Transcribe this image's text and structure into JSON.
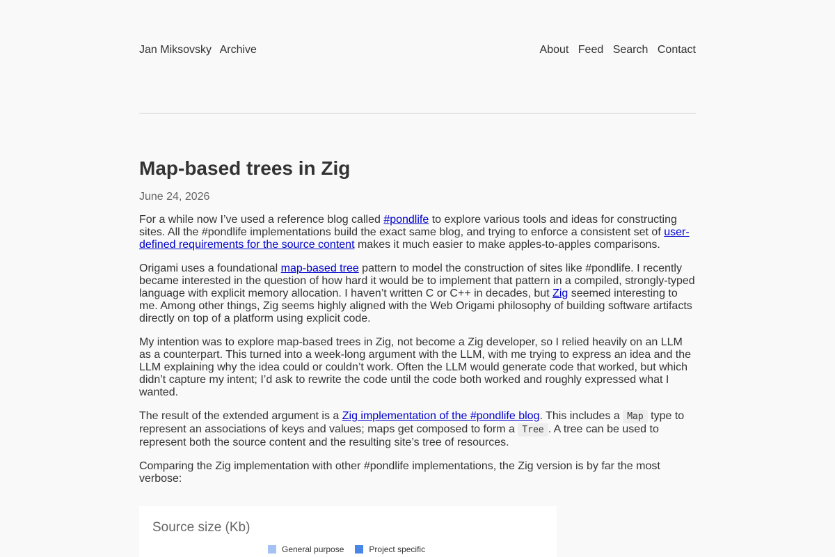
{
  "nav": {
    "left": [
      "Jan Miksovsky",
      "Archive"
    ],
    "right": [
      "About",
      "Feed",
      "Search",
      "Contact"
    ]
  },
  "post": {
    "title": "Map-based trees in Zig",
    "date": "June 24, 2026",
    "p1": {
      "t1": "For a while now I’ve used a reference blog called ",
      "link1": "#pondlife",
      "t2": " to explore various tools and ideas for constructing sites. All the #pondlife implementations build the exact same blog, and trying to enforce a consistent set of ",
      "link2": "user-defined requirements for the source content",
      "t3": " makes it much easier to make apples-to-apples comparisons."
    },
    "p2": {
      "t1": "Origami uses a foundational ",
      "link1": "map-based tree",
      "t2": " pattern to model the construction of sites like #pondlife. I recently became interested in the question of how hard it would be to implement that pattern in a compiled, strongly-typed language with explicit memory allocation. I haven’t written C or C++ in decades, but ",
      "link2": "Zig",
      "t3": " seemed interesting to me. Among other things, Zig seems highly aligned with the Web Origami philosophy of building software artifacts directly on top of a platform using explicit code."
    },
    "p3": "My intention was to explore map-based trees in Zig, not become a Zig developer, so I relied heavily on an LLM as a counterpart. This turned into a week-long argument with the LLM, with me trying to express an idea and the LLM explaining why the idea could or couldn’t work. Often the LLM would generate code that worked, but which didn’t capture my intent; I’d ask to rewrite the code until the code both worked and roughly expressed what I wanted.",
    "p4": {
      "t1": "The result of the extended argument is a ",
      "link1": "Zig implementation of the #pondlife blog",
      "t2": ". This includes a ",
      "code1": "Map",
      "t3": " type to represent an associations of keys and values; maps get composed to form a ",
      "code2": "Tree",
      "t4": ". A tree can be used to represent both the source content and the resulting site’s tree of resources."
    },
    "p5": "Comparing the Zig implementation with other #pondlife implementations, the Zig version is by far the most verbose:"
  },
  "chart": {
    "title": "Source size (Kb)",
    "legend": [
      {
        "label": "General purpose",
        "color": "#a4c2f4"
      },
      {
        "label": "Project specific",
        "color": "#4a86e8"
      }
    ]
  }
}
